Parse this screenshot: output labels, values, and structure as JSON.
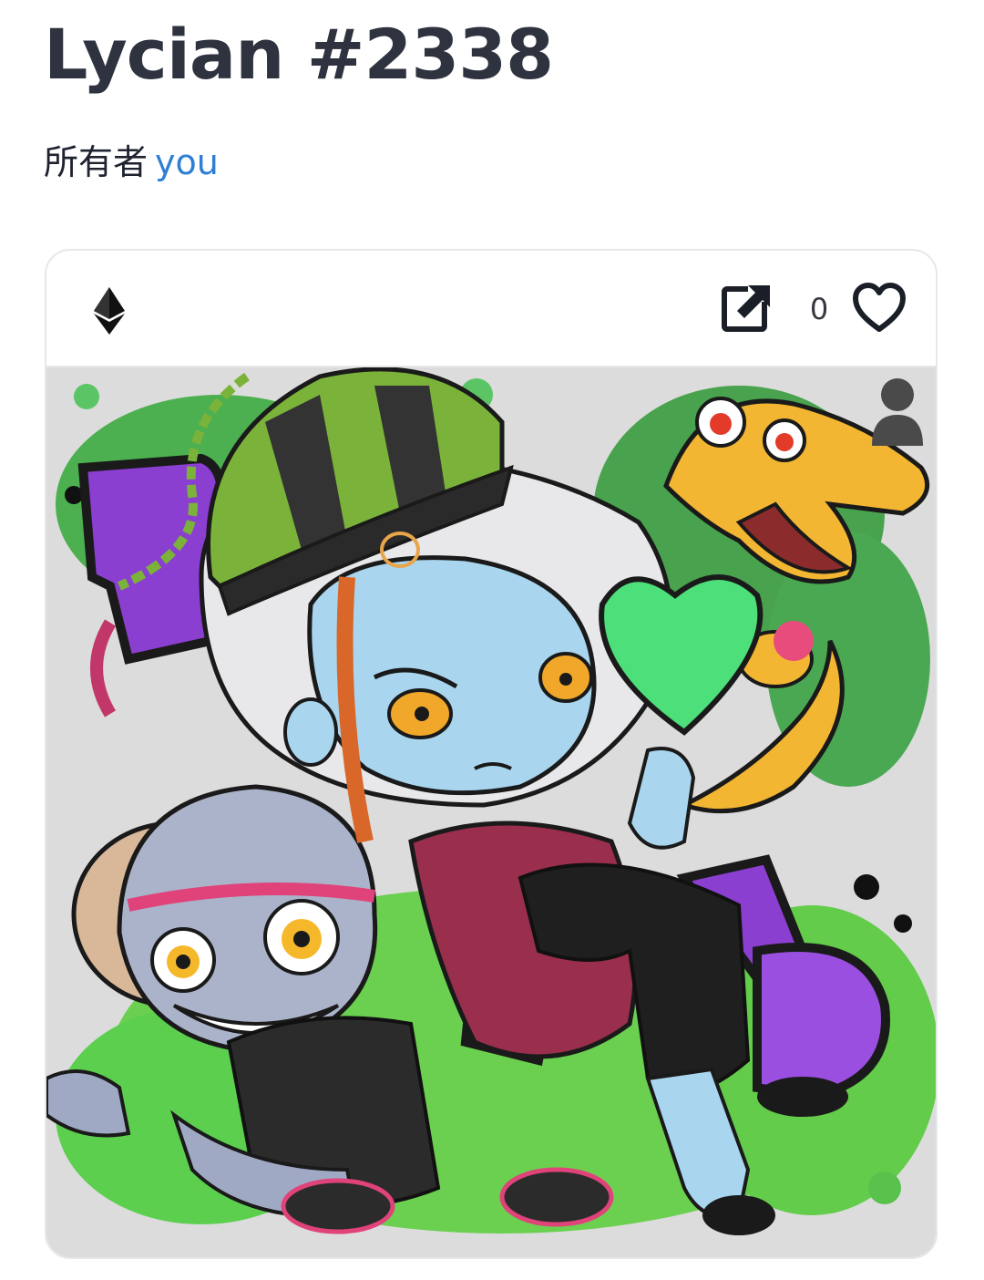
{
  "header": {
    "title": "Lycian #2338",
    "owner_prefix": "所有者",
    "owner_name": "you"
  },
  "card": {
    "chain_icon": "ethereum-icon",
    "external_link_icon": "open-in-new-icon",
    "favorites_count": "0",
    "favorite_icon": "heart-outline-icon",
    "owner_avatar_icon": "person-icon",
    "artwork_alt": "Lycian #2338"
  },
  "colors": {
    "title": "#2f3340",
    "link": "#2f7fd4",
    "border": "#e5e8eb",
    "artwork_bg": "#dcdcdc"
  }
}
